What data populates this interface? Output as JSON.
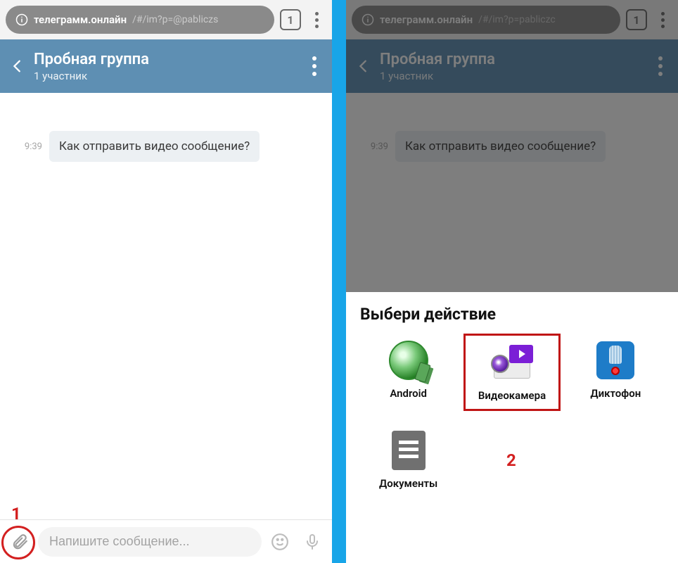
{
  "left": {
    "browser": {
      "url_host": "телеграмм.онлайн",
      "url_path": "/#/im?p=@pabliczs",
      "tab_count": "1"
    },
    "chat": {
      "title": "Пробная группа",
      "subtitle": "1 участник",
      "message_time": "9:39",
      "message_text": "Как отправить видео сообщение?",
      "input_placeholder": "Напишите сообщение..."
    },
    "annotation_num": "1"
  },
  "right": {
    "browser": {
      "url_host": "телеграмм.онлайн",
      "url_path": "/#/im?p=pabliczc",
      "tab_count": "1"
    },
    "chat": {
      "title": "Пробная группа",
      "subtitle": "1 участник",
      "message_time": "9:39",
      "message_text": "Как отправить видео сообщение?"
    },
    "sheet": {
      "title": "Выбери действие",
      "items": [
        {
          "label": "Android"
        },
        {
          "label": "Видеокамера"
        },
        {
          "label": "Диктофон"
        },
        {
          "label": "Документы"
        }
      ]
    },
    "annotation_num": "2"
  }
}
